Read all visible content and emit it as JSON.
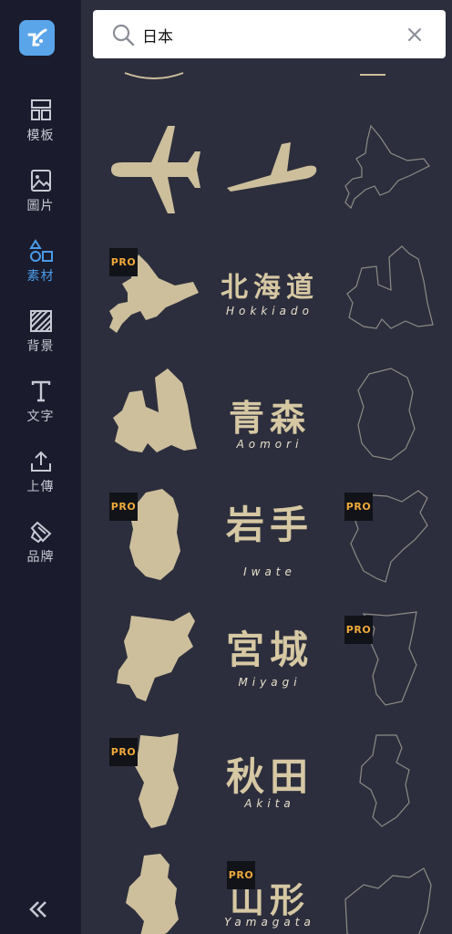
{
  "sidebar": {
    "items": [
      {
        "label": "模板",
        "icon": "template-icon"
      },
      {
        "label": "圖片",
        "icon": "image-icon"
      },
      {
        "label": "素材",
        "icon": "elements-icon"
      },
      {
        "label": "背景",
        "icon": "background-icon"
      },
      {
        "label": "文字",
        "icon": "text-icon"
      },
      {
        "label": "上傳",
        "icon": "upload-icon"
      },
      {
        "label": "品牌",
        "icon": "brand-icon"
      }
    ],
    "active": "素材",
    "collapse_icon": "double-chevron-left-icon"
  },
  "search": {
    "value": "日本",
    "placeholder": ""
  },
  "badges": {
    "pro": "PRO"
  },
  "prefectures": [
    {
      "kanji": "北海道",
      "romaji": "Hokkiado"
    },
    {
      "kanji": "青森",
      "romaji": "Aomori"
    },
    {
      "kanji": "岩手",
      "romaji": "Iwate"
    },
    {
      "kanji": "宮城",
      "romaji": "Miyagi"
    },
    {
      "kanji": "秋田",
      "romaji": "Akita"
    },
    {
      "kanji": "山形",
      "romaji": "Yamagata"
    }
  ],
  "colors": {
    "accent": "#4a9be8",
    "sidebar_bg": "#1a1b2c",
    "panel_bg": "#2c2e3d",
    "element_fill": "#cdbf9c",
    "pro_text": "#f0a93b"
  }
}
